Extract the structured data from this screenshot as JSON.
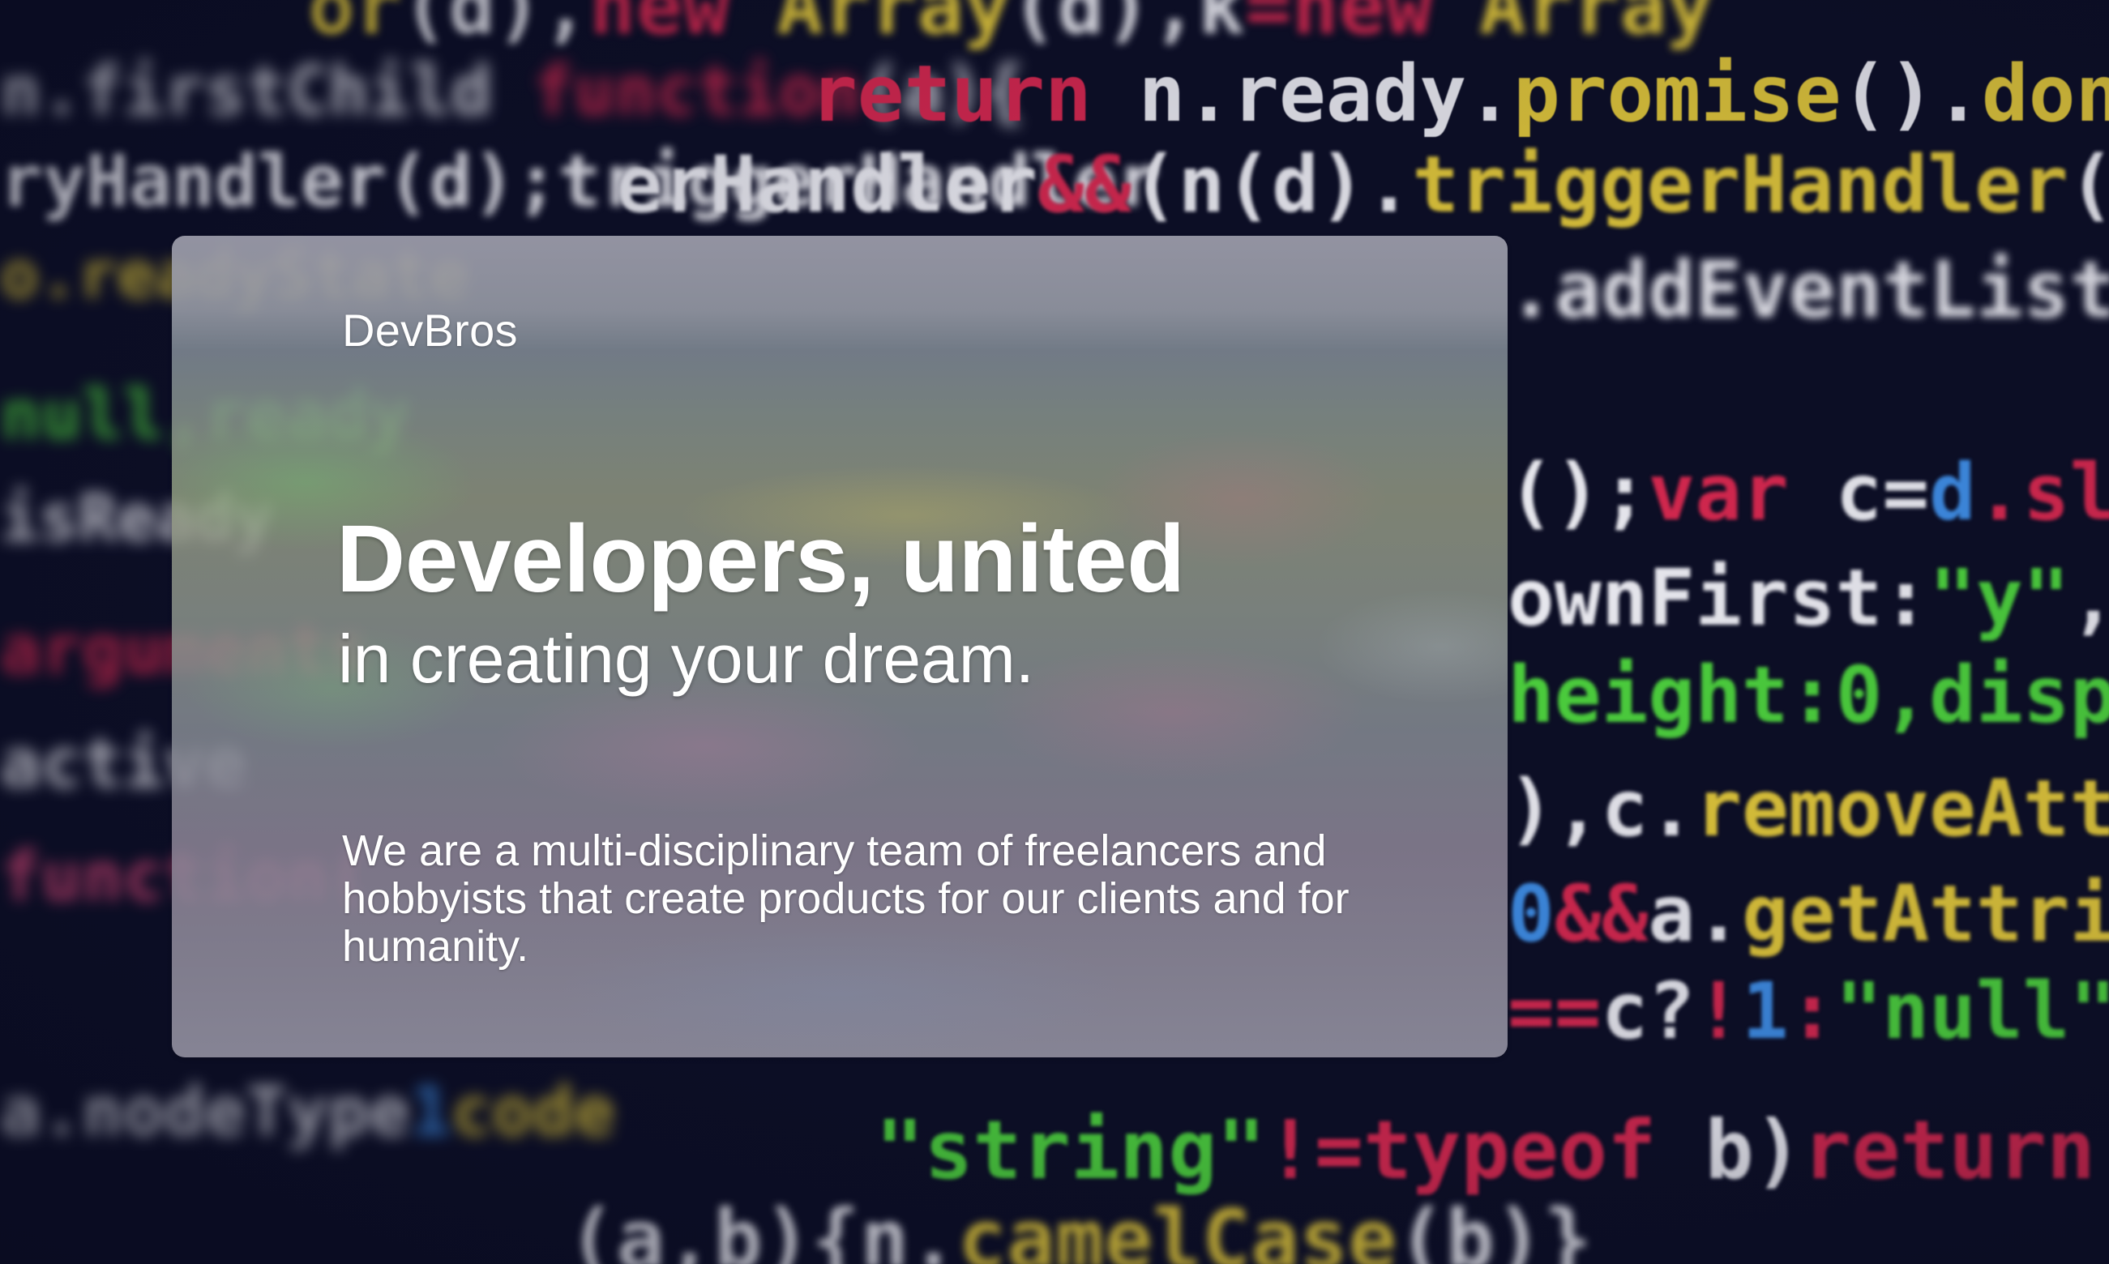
{
  "hero": {
    "brand": "DevBros",
    "headline": "Developers, united",
    "subheadline": "in creating your dream.",
    "description": "We are a multi-disciplinary team of freelancers and hobbyists that create products for our clients and for humanity."
  },
  "background": {
    "description_type": "blurred source code photograph",
    "code_fragments": [
      "Array(d),k=new Array",
      "return n.ready.promise().done",
      "erHandler&&(n(d).triggerHandler",
      ".addEvent",
      "();var",
      "ownFirst",
      "height:0,",
      "),c.removeAt",
      "0&&a.getAttr",
      "==c?!1:\"null\"",
      "\"string\"!=typeof b)return",
      "n.camelCase(b)"
    ],
    "colors": {
      "base": "#0c0e25",
      "white": "#ececf2",
      "yellow": "#e2c83a",
      "red": "#d8284f",
      "green": "#4dd23d",
      "blue": "#3f8ee6"
    }
  },
  "card": {
    "style": "frosted-glass"
  }
}
